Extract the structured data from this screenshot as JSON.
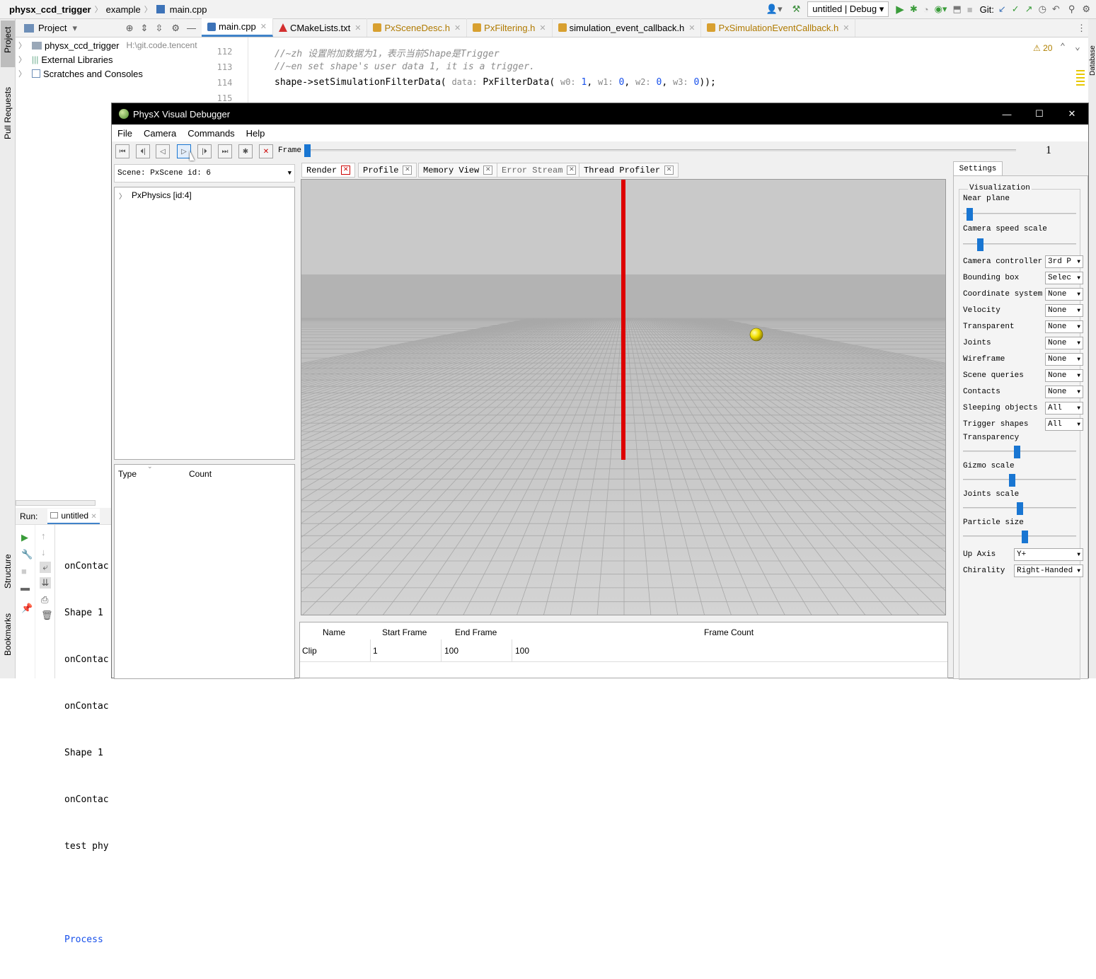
{
  "ide": {
    "breadcrumb": [
      "physx_ccd_trigger",
      "example",
      "main.cpp"
    ],
    "run_config": "untitled | Debug",
    "git_label": "Git:",
    "warnings_count": "20",
    "tabs": [
      {
        "label": "main.cpp",
        "icon_color": "#3d73b8",
        "active": true
      },
      {
        "label": "CMakeLists.txt",
        "icon_color": "#d32f2f"
      },
      {
        "label": "PxSceneDesc.h",
        "icon_color": "#d8a030"
      },
      {
        "label": "PxFiltering.h",
        "icon_color": "#d8a030"
      },
      {
        "label": "simulation_event_callback.h",
        "icon_color": "#d8a030"
      },
      {
        "label": "PxSimulationEventCallback.h",
        "icon_color": "#d8a030"
      }
    ],
    "project": {
      "header": "Project",
      "items": [
        {
          "label": "physx_ccd_trigger",
          "path": "H:\\git.code.tencent"
        },
        {
          "label": "External Libraries"
        },
        {
          "label": "Scratches and Consoles"
        }
      ]
    },
    "left_strip": [
      "Project",
      "Pull Requests",
      "Structure",
      "Bookmarks"
    ],
    "editor": {
      "lines": [
        {
          "num": "112",
          "text": "//~zh 设置附加数据为1，表示当前Shape是Trigger"
        },
        {
          "num": "113",
          "text": "//~en set shape's user data 1, it is a trigger."
        },
        {
          "num": "114",
          "code_pre": "shape->setSimulationFilterData( ",
          "hint_data": "data:",
          "code_mid": " PxFilterData( ",
          "hint_w0": "w0:",
          "v0": "1",
          "hint_w1": "w1:",
          "v1": "0",
          "hint_w2": "w2:",
          "v2": "0",
          "hint_w3": "w3:",
          "v3": "0",
          "code_end": "));"
        },
        {
          "num": "115",
          "text": ""
        }
      ]
    },
    "run": {
      "label": "Run:",
      "config": "untitled",
      "output": [
        "onContac",
        "Shape 1 ",
        "onContac",
        "onContac",
        "Shape 1 ",
        "onContac",
        "test phy",
        "",
        "Process "
      ]
    }
  },
  "pvd": {
    "title": "PhysX Visual Debugger",
    "menu": [
      "File",
      "Camera",
      "Commands",
      "Help"
    ],
    "frame_label": "Frame",
    "frame_value": "1",
    "frame_slider": 0.0,
    "scene_select": "Scene: PxScene id: 6",
    "tree_root": "PxPhysics [id:4]",
    "type_headers": [
      "Type",
      "Count"
    ],
    "tabs": [
      "Render",
      "Profile",
      "Memory View",
      "Error Stream",
      "Thread Profiler"
    ],
    "clip_table": {
      "headers": [
        "Name",
        "Start Frame",
        "End Frame",
        "Frame Count"
      ],
      "rows": [
        [
          "Clip",
          "1",
          "100",
          "100"
        ]
      ]
    },
    "settings": {
      "tab": "Settings",
      "group": "Visualization",
      "near_plane": {
        "label": "Near plane",
        "value": 0.03
      },
      "camera_speed_scale": {
        "label": "Camera speed scale",
        "value": 0.13
      },
      "dropdowns": [
        {
          "label": "Camera controller",
          "value": "3rd P"
        },
        {
          "label": "Bounding box",
          "value": "Selec"
        },
        {
          "label": "Coordinate system",
          "value": "None"
        },
        {
          "label": "Velocity",
          "value": "None"
        },
        {
          "label": "Transparent",
          "value": "None"
        },
        {
          "label": "Joints",
          "value": "None"
        },
        {
          "label": "Wireframe",
          "value": "None"
        },
        {
          "label": "Scene queries",
          "value": "None"
        },
        {
          "label": "Contacts",
          "value": "None"
        },
        {
          "label": "Sleeping objects",
          "value": "All"
        },
        {
          "label": "Trigger shapes",
          "value": "All"
        }
      ],
      "sliders": [
        {
          "label": "Transparency",
          "value": 0.48
        },
        {
          "label": "Gizmo scale",
          "value": 0.43
        },
        {
          "label": "Joints scale",
          "value": 0.5
        },
        {
          "label": "Particle size",
          "value": 0.55
        }
      ],
      "up_axis": {
        "label": "Up Axis",
        "value": "Y+"
      },
      "chirality": {
        "label": "Chirality",
        "value": "Right-Handed"
      }
    },
    "colors": {
      "accent": "#1976d2",
      "pillar": "#dd0000",
      "ball": "#f2e000"
    }
  }
}
